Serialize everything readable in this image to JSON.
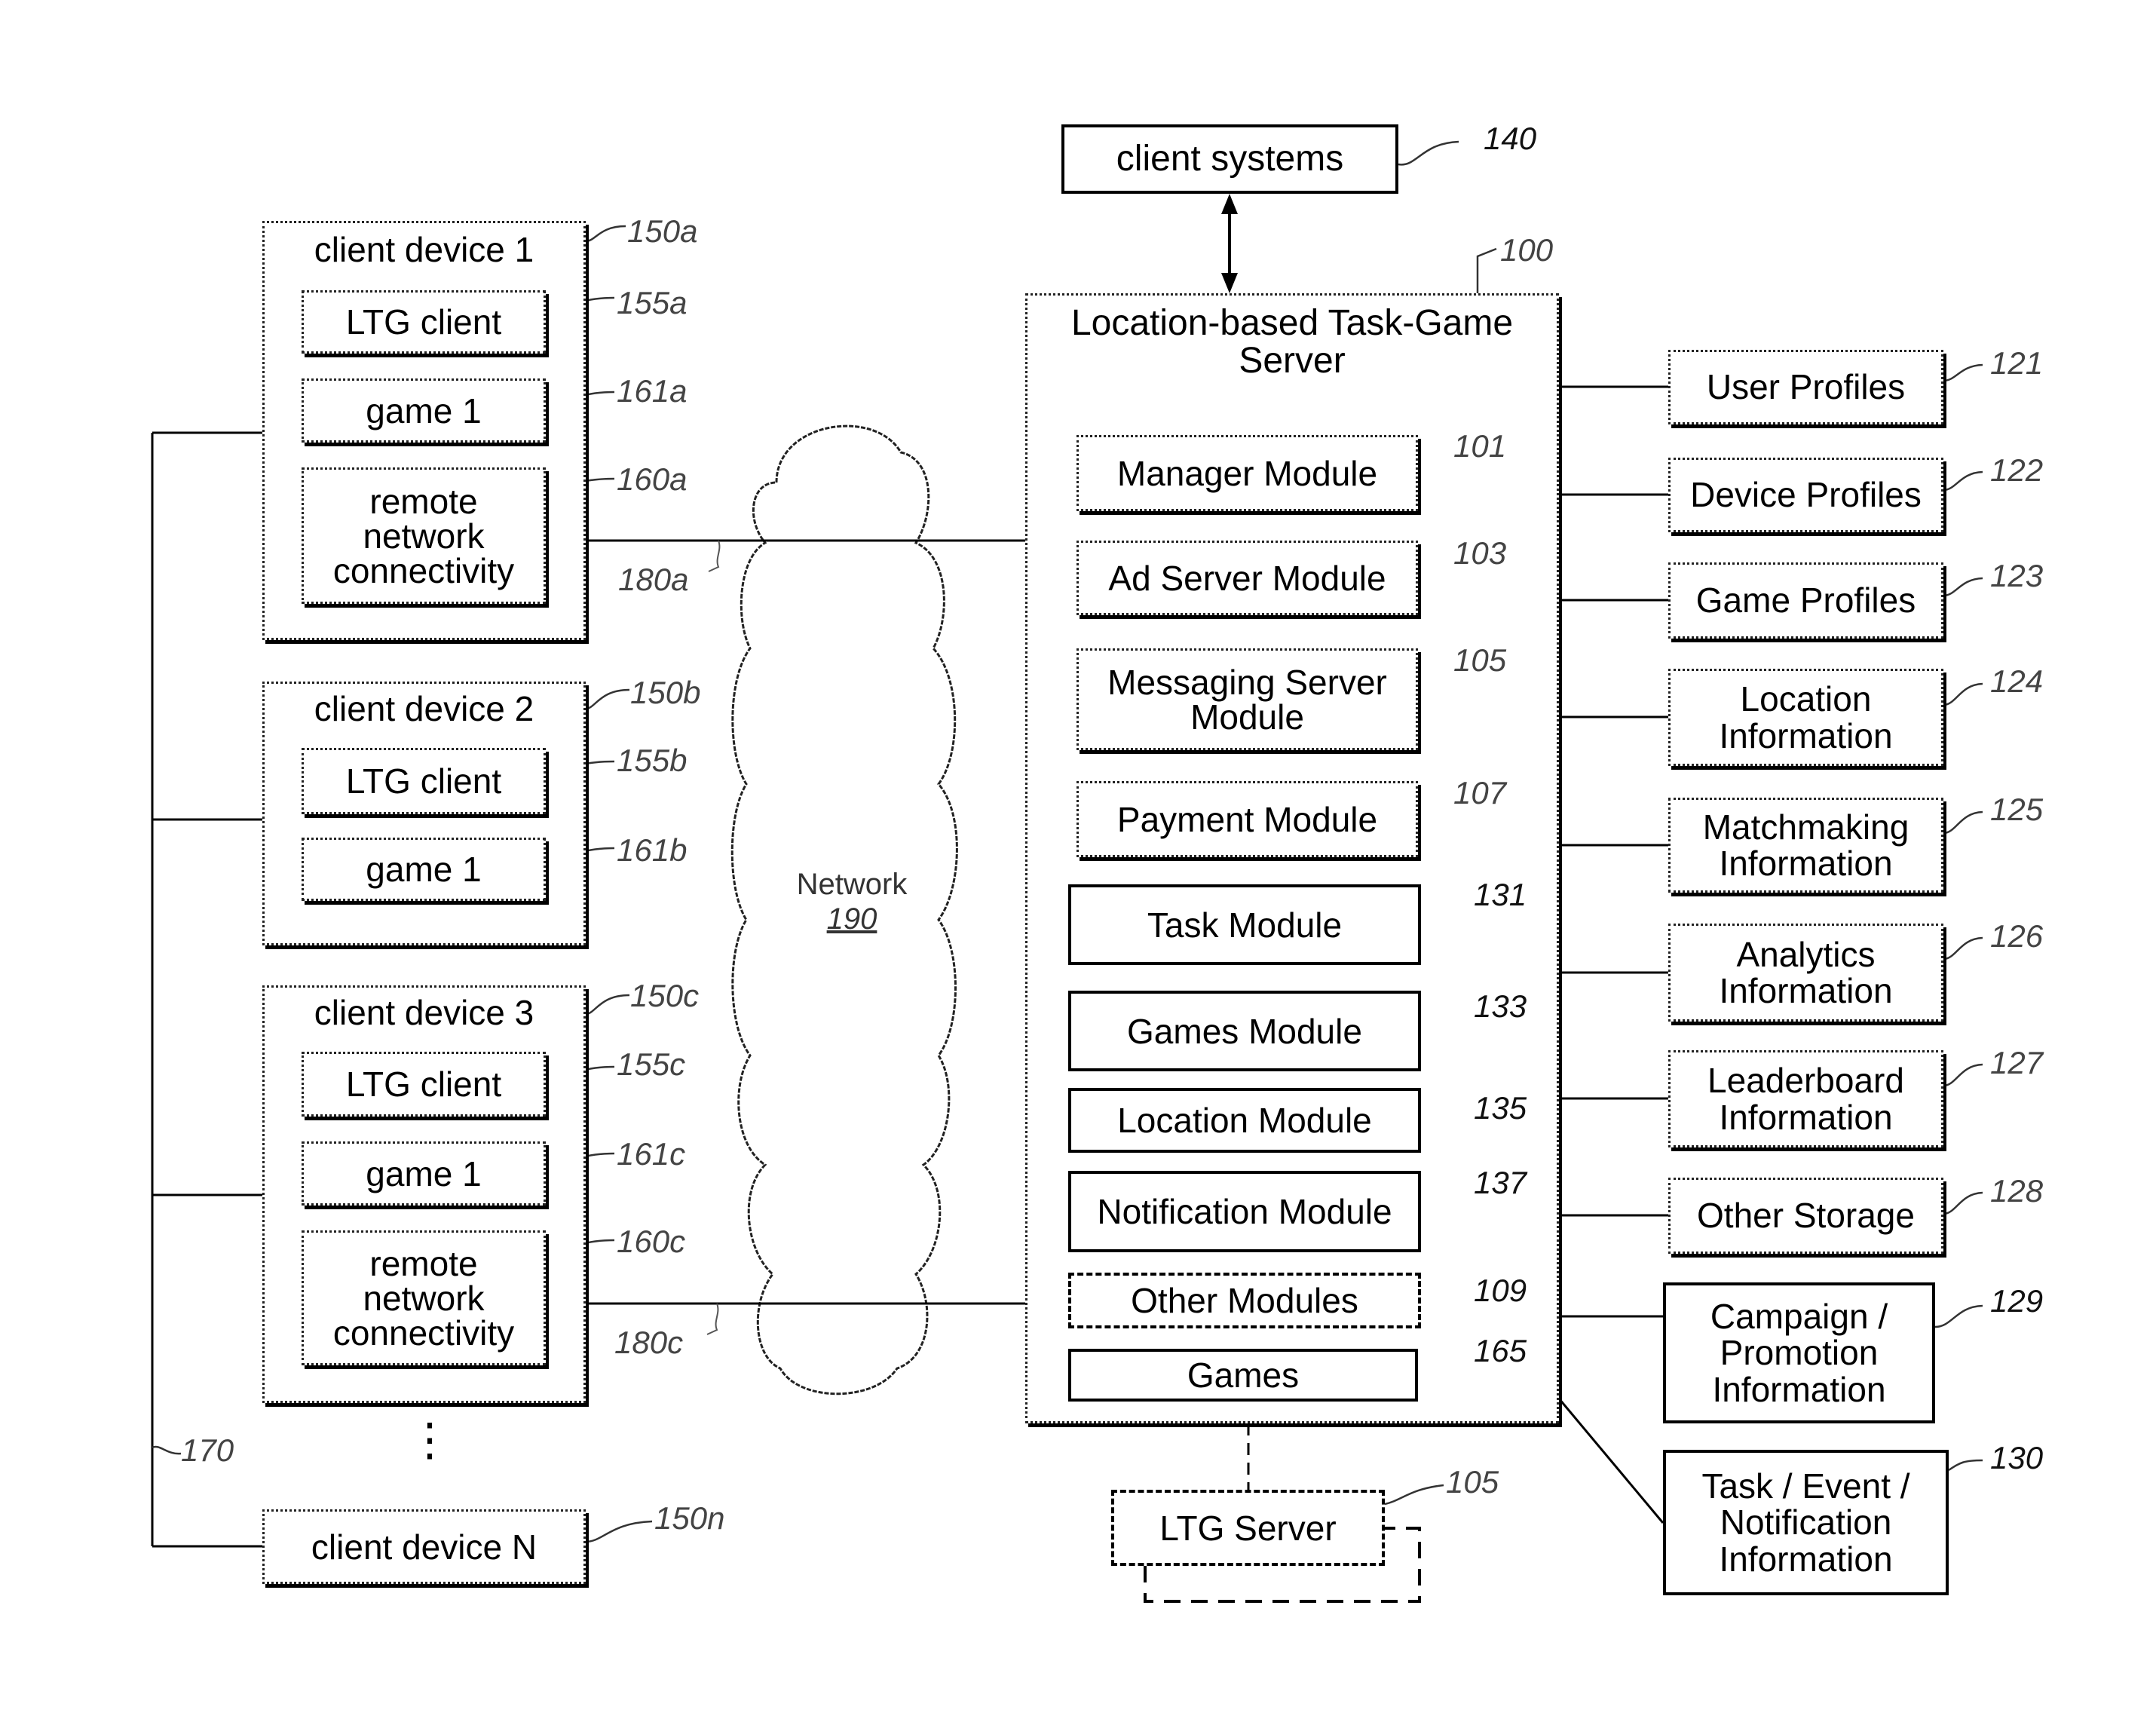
{
  "client_systems": {
    "label": "client systems",
    "ref": "140"
  },
  "server": {
    "title_line1": "Location-based Task-Game",
    "title_line2": "Server",
    "ref": "100",
    "modules": [
      {
        "label": "Manager Module",
        "ref": "101",
        "style": "hatched"
      },
      {
        "label": "Ad Server Module",
        "ref": "103",
        "style": "hatched"
      },
      {
        "label_line1": "Messaging Server",
        "label_line2": "Module",
        "ref": "105",
        "style": "hatched"
      },
      {
        "label": "Payment Module",
        "ref": "107",
        "style": "hatched"
      },
      {
        "label": "Task Module",
        "ref": "131",
        "style": "solid"
      },
      {
        "label": "Games Module",
        "ref": "133",
        "style": "solid"
      },
      {
        "label": "Location Module",
        "ref": "135",
        "style": "solid"
      },
      {
        "label": "Notification Module",
        "ref": "137",
        "style": "solid"
      },
      {
        "label": "Other Modules",
        "ref": "109",
        "style": "dashed"
      },
      {
        "label": "Games",
        "ref": "165",
        "style": "solid"
      }
    ]
  },
  "ltg_server": {
    "label": "LTG Server",
    "ref": "105"
  },
  "storage": [
    {
      "lines": [
        "User Profiles"
      ],
      "ref": "121"
    },
    {
      "lines": [
        "Device Profiles"
      ],
      "ref": "122"
    },
    {
      "lines": [
        "Game Profiles"
      ],
      "ref": "123"
    },
    {
      "lines": [
        "Location",
        "Information"
      ],
      "ref": "124"
    },
    {
      "lines": [
        "Matchmaking",
        "Information"
      ],
      "ref": "125"
    },
    {
      "lines": [
        "Analytics",
        "Information"
      ],
      "ref": "126"
    },
    {
      "lines": [
        "Leaderboard",
        "Information"
      ],
      "ref": "127"
    },
    {
      "lines": [
        "Other Storage"
      ],
      "ref": "128"
    },
    {
      "lines": [
        "Campaign /",
        "Promotion",
        "Information"
      ],
      "ref": "129"
    },
    {
      "lines": [
        "Task / Event /",
        "Notification",
        "Information"
      ],
      "ref": "130"
    }
  ],
  "network": {
    "label": "Network",
    "ref": "190"
  },
  "client_devices": [
    {
      "label": "client device 1",
      "ref": "150a",
      "ltg_client": {
        "label": "LTG client",
        "ref": "155a"
      },
      "game": {
        "label": "game 1",
        "ref": "161a"
      },
      "remote": {
        "lines": [
          "remote",
          "network",
          "connectivity"
        ],
        "ref": "160a"
      },
      "link_ref": "180a"
    },
    {
      "label": "client device 2",
      "ref": "150b",
      "ltg_client": {
        "label": "LTG client",
        "ref": "155b"
      },
      "game": {
        "label": "game 1",
        "ref": "161b"
      }
    },
    {
      "label": "client device 3",
      "ref": "150c",
      "ltg_client": {
        "label": "LTG client",
        "ref": "155c"
      },
      "game": {
        "label": "game 1",
        "ref": "161c"
      },
      "remote": {
        "lines": [
          "remote",
          "network",
          "connectivity"
        ],
        "ref": "160c"
      },
      "link_ref": "180c"
    },
    {
      "label": "client device N",
      "ref": "150n"
    }
  ],
  "bus": {
    "ref": "170"
  },
  "ellipsis": "⋮"
}
